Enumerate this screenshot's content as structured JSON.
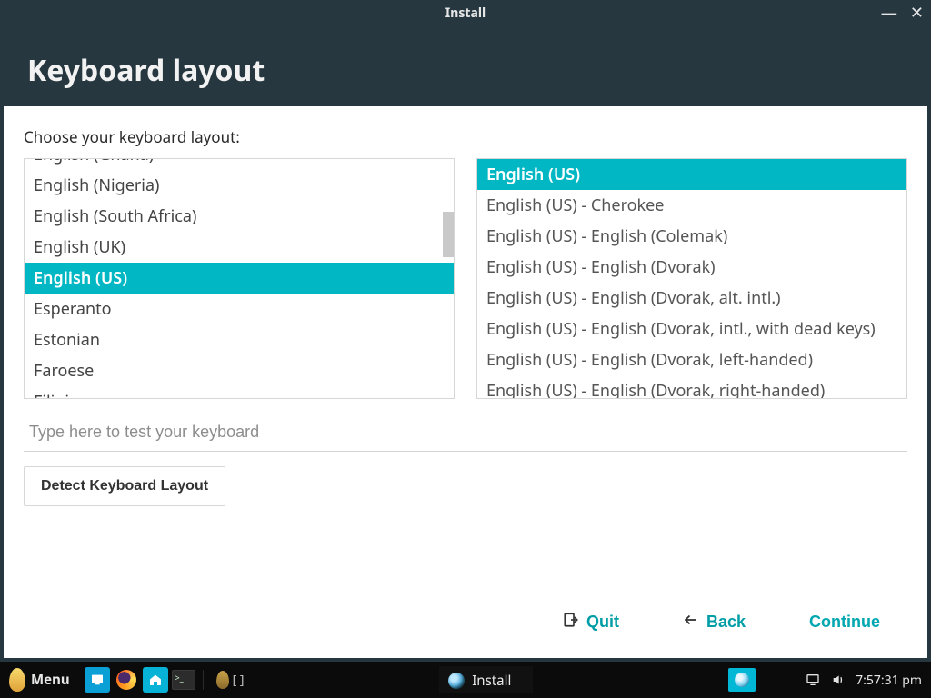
{
  "window": {
    "title": "Install",
    "page_heading": "Keyboard layout"
  },
  "content": {
    "prompt": "Choose your keyboard layout:",
    "left_list": {
      "items": [
        "English (Ghana)",
        "English (Nigeria)",
        "English (South Africa)",
        "English (UK)",
        "English (US)",
        "Esperanto",
        "Estonian",
        "Faroese",
        "Filipino"
      ],
      "selected_index": 4
    },
    "right_list": {
      "items": [
        "English (US)",
        "English (US) - Cherokee",
        "English (US) - English (Colemak)",
        "English (US) - English (Dvorak)",
        "English (US) - English (Dvorak, alt. intl.)",
        "English (US) - English (Dvorak, intl., with dead keys)",
        "English (US) - English (Dvorak, left-handed)",
        "English (US) - English (Dvorak, right-handed)"
      ],
      "selected_index": 0
    },
    "test_placeholder": "Type here to test your keyboard",
    "detect_button": "Detect Keyboard Layout",
    "nav": {
      "quit": "Quit",
      "back": "Back",
      "continue": "Continue"
    }
  },
  "taskbar": {
    "menu_label": "Menu",
    "workspace": "[ ]",
    "task_label": "Install",
    "clock": "7:57:31 pm"
  },
  "colors": {
    "accent": "#00b7c3",
    "header_bg": "#263740"
  }
}
